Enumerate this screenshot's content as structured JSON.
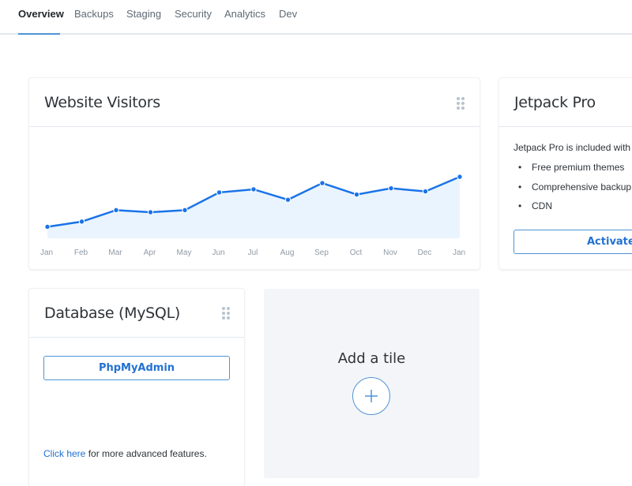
{
  "tabs": [
    {
      "label": "Overview",
      "active": true
    },
    {
      "label": "Backups",
      "active": false
    },
    {
      "label": "Staging",
      "active": false
    },
    {
      "label": "Security",
      "active": false
    },
    {
      "label": "Analytics",
      "active": false
    },
    {
      "label": "Dev",
      "active": false
    }
  ],
  "visitors_card": {
    "title": "Website Visitors",
    "drag_icon": "drag-handle-icon"
  },
  "chart_data": {
    "type": "area",
    "title": "Website Visitors",
    "categories": [
      "Jan",
      "Feb",
      "Mar",
      "Apr",
      "May",
      "Jun",
      "Jul",
      "Aug",
      "Sep",
      "Oct",
      "Nov",
      "Dec",
      "Jan"
    ],
    "series": [
      {
        "name": "Visitors",
        "values": [
          11,
          16,
          27,
          25,
          27,
          44,
          47,
          37,
          53,
          42,
          48,
          45,
          59
        ]
      }
    ],
    "xlabel": "",
    "ylabel": "",
    "ylim": [
      0,
      100
    ],
    "grid": false,
    "legend": "none",
    "colors": {
      "line": "#1a73e8",
      "fill": "#eaf4fe"
    }
  },
  "jetpack_card": {
    "title": "Jetpack Pro",
    "description": "Jetpack Pro is included with",
    "features": [
      "Free premium themes",
      "Comprehensive backup",
      "CDN"
    ],
    "activate_label": "Activate"
  },
  "database_card": {
    "title": "Database (MySQL)",
    "drag_icon": "drag-handle-icon",
    "phpmyadmin_label": "PhpMyAdmin",
    "link_text": "Click here",
    "link_suffix": " for more advanced features."
  },
  "add_tile": {
    "title": "Add a tile",
    "icon": "plus-icon"
  },
  "colors": {
    "accent": "#4f94d4",
    "link": "#2271d1",
    "tile_bg": "#f3f5f9"
  }
}
